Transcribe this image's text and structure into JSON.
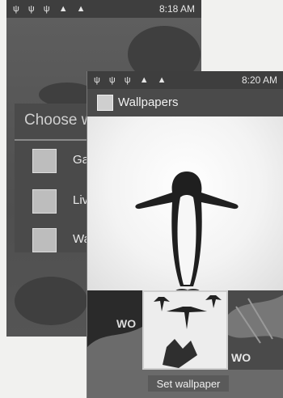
{
  "back_screen": {
    "status": {
      "icons": "ψ ψ ψ ▲ ▲",
      "time": "8:18 AM"
    },
    "dialog": {
      "title": "Choose wa",
      "options": [
        {
          "label": "Galle",
          "icon": "gallery-icon"
        },
        {
          "label": "Live",
          "icon": "live-wallpaper-icon"
        },
        {
          "label": "Wallp",
          "icon": "wallpaper-icon"
        }
      ]
    }
  },
  "front_screen": {
    "status": {
      "icons": "ψ ψ ψ ▲ ▲",
      "time": "8:20 AM"
    },
    "actionbar": {
      "title": "Wallpapers",
      "icon": "wallpapers-app-icon"
    },
    "set_button": "Set wallpaper",
    "thumbnail_marks": [
      "WO",
      "WO"
    ]
  }
}
